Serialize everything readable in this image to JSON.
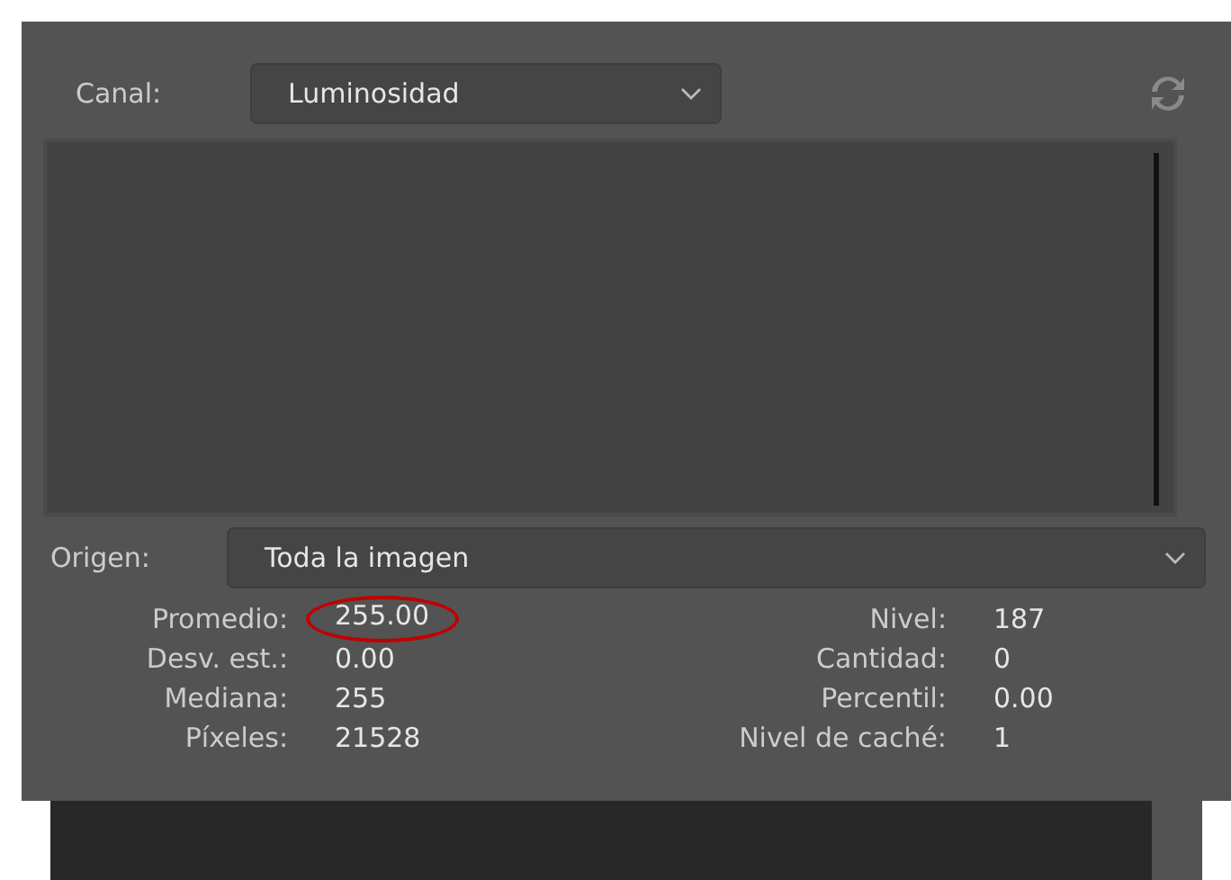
{
  "channel": {
    "label": "Canal:",
    "value": "Luminosidad"
  },
  "source": {
    "label": "Origen:",
    "value": "Toda la imagen"
  },
  "stats_left": [
    {
      "label": "Promedio:",
      "value": "255.00",
      "highlighted": true
    },
    {
      "label": "Desv. est.:",
      "value": "0.00",
      "highlighted": false
    },
    {
      "label": "Mediana:",
      "value": "255",
      "highlighted": false
    },
    {
      "label": "Píxeles:",
      "value": "21528",
      "highlighted": false
    }
  ],
  "stats_right": [
    {
      "label": "Nivel:",
      "value": "187",
      "highlighted": false
    },
    {
      "label": "Cantidad:",
      "value": "0",
      "highlighted": false
    },
    {
      "label": "Percentil:",
      "value": "0.00",
      "highlighted": false
    },
    {
      "label": "Nivel de caché:",
      "value": "1",
      "highlighted": false
    }
  ]
}
